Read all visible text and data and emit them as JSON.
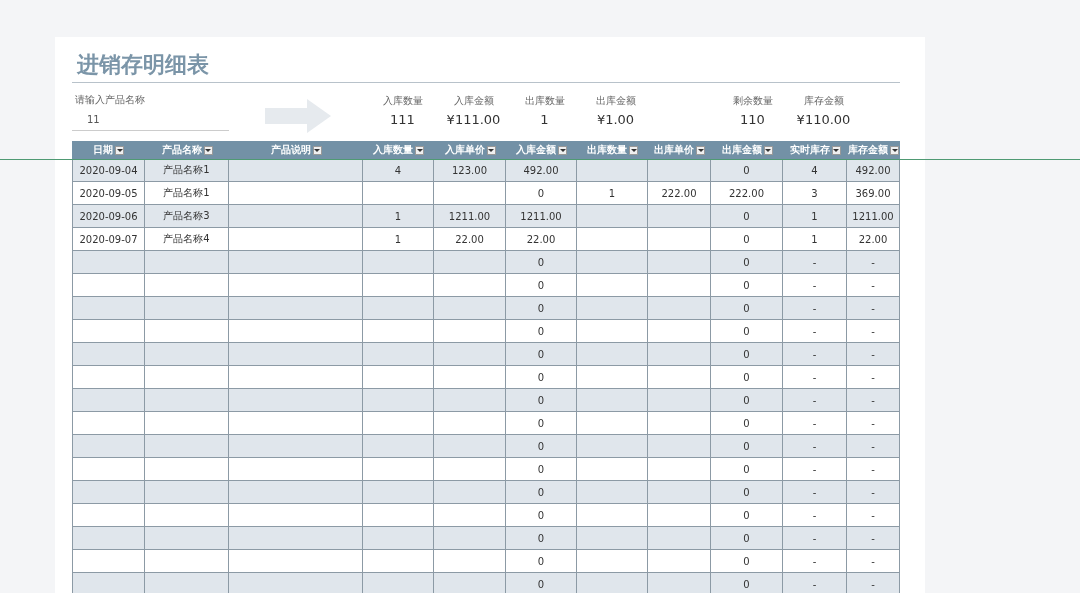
{
  "title": "进销存明细表",
  "search": {
    "label": "请输入产品名称",
    "value": "11"
  },
  "summary": [
    {
      "label": "入库数量",
      "value": "111"
    },
    {
      "label": "入库金额",
      "value": "¥111.00"
    },
    {
      "label": "出库数量",
      "value": "1"
    },
    {
      "label": "出库金额",
      "value": "¥1.00"
    },
    {
      "label": "剩余数量",
      "value": "110"
    },
    {
      "label": "库存金额",
      "value": "¥110.00"
    }
  ],
  "table": {
    "columns": [
      "日期",
      "产品名称",
      "产品说明",
      "入库数量",
      "入库单价",
      "入库金额",
      "出库数量",
      "出库单价",
      "出库金额",
      "实时库存",
      "库存金额"
    ],
    "rows": [
      [
        "2020-09-04",
        "产品名称1",
        "",
        "4",
        "123.00",
        "492.00",
        "",
        "",
        "0",
        "4",
        "492.00"
      ],
      [
        "2020-09-05",
        "产品名称1",
        "",
        "",
        "",
        "0",
        "1",
        "222.00",
        "222.00",
        "3",
        "369.00"
      ],
      [
        "2020-09-06",
        "产品名称3",
        "",
        "1",
        "1211.00",
        "1211.00",
        "",
        "",
        "0",
        "1",
        "1211.00"
      ],
      [
        "2020-09-07",
        "产品名称4",
        "",
        "1",
        "22.00",
        "22.00",
        "",
        "",
        "0",
        "1",
        "22.00"
      ],
      [
        "",
        "",
        "",
        "",
        "",
        "0",
        "",
        "",
        "0",
        "-",
        "-"
      ],
      [
        "",
        "",
        "",
        "",
        "",
        "0",
        "",
        "",
        "0",
        "-",
        "-"
      ],
      [
        "",
        "",
        "",
        "",
        "",
        "0",
        "",
        "",
        "0",
        "-",
        "-"
      ],
      [
        "",
        "",
        "",
        "",
        "",
        "0",
        "",
        "",
        "0",
        "-",
        "-"
      ],
      [
        "",
        "",
        "",
        "",
        "",
        "0",
        "",
        "",
        "0",
        "-",
        "-"
      ],
      [
        "",
        "",
        "",
        "",
        "",
        "0",
        "",
        "",
        "0",
        "-",
        "-"
      ],
      [
        "",
        "",
        "",
        "",
        "",
        "0",
        "",
        "",
        "0",
        "-",
        "-"
      ],
      [
        "",
        "",
        "",
        "",
        "",
        "0",
        "",
        "",
        "0",
        "-",
        "-"
      ],
      [
        "",
        "",
        "",
        "",
        "",
        "0",
        "",
        "",
        "0",
        "-",
        "-"
      ],
      [
        "",
        "",
        "",
        "",
        "",
        "0",
        "",
        "",
        "0",
        "-",
        "-"
      ],
      [
        "",
        "",
        "",
        "",
        "",
        "0",
        "",
        "",
        "0",
        "-",
        "-"
      ],
      [
        "",
        "",
        "",
        "",
        "",
        "0",
        "",
        "",
        "0",
        "-",
        "-"
      ],
      [
        "",
        "",
        "",
        "",
        "",
        "0",
        "",
        "",
        "0",
        "-",
        "-"
      ],
      [
        "",
        "",
        "",
        "",
        "",
        "0",
        "",
        "",
        "0",
        "-",
        "-"
      ],
      [
        "",
        "",
        "",
        "",
        "",
        "0",
        "",
        "",
        "0",
        "-",
        "-"
      ]
    ]
  }
}
